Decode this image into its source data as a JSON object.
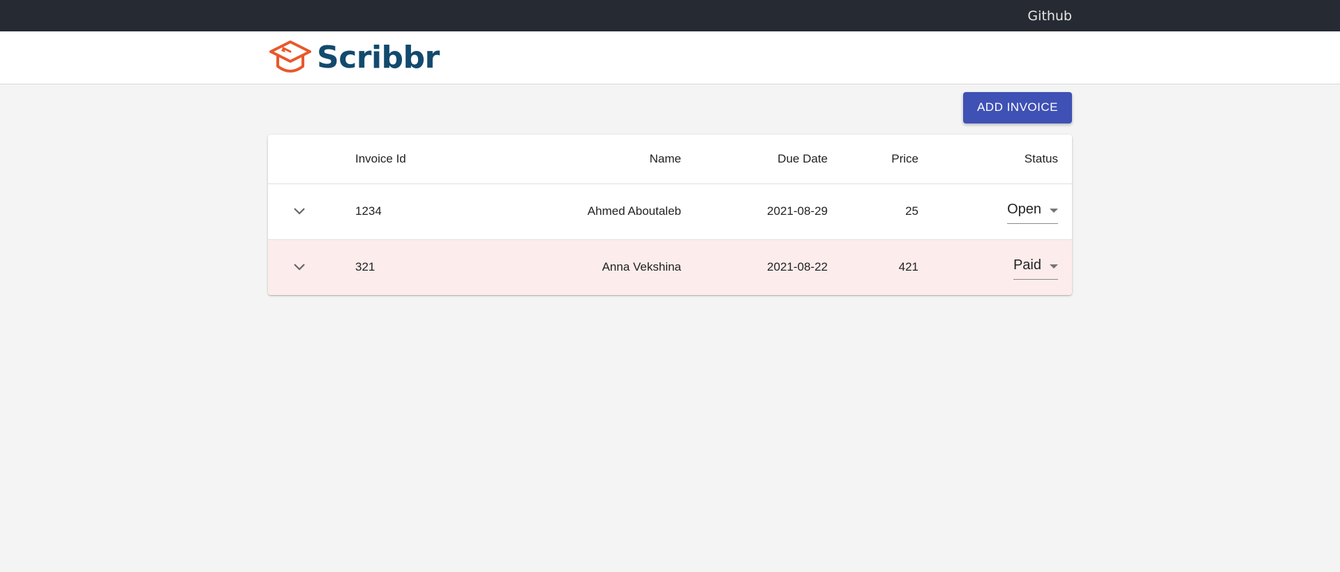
{
  "topbar": {
    "github_label": "Github"
  },
  "brand": {
    "name": "Scribbr",
    "logo_color": "#e8582a",
    "text_color": "#124a6e"
  },
  "actions": {
    "add_invoice_label": "ADD INVOICE",
    "button_color": "#3f51b5"
  },
  "table": {
    "headers": {
      "invoice_id": "Invoice Id",
      "name": "Name",
      "due_date": "Due Date",
      "price": "Price",
      "status": "Status"
    },
    "rows": [
      {
        "invoice_id": "1234",
        "name": "Ahmed Aboutaleb",
        "due_date": "2021-08-29",
        "price": "25",
        "status": "Open",
        "expand_icon": "chevron-down-icon"
      },
      {
        "invoice_id": "321",
        "name": "Anna Vekshina",
        "due_date": "2021-08-22",
        "price": "421",
        "status": "Paid",
        "expand_icon": "chevron-down-icon",
        "row_color": "#fdecec"
      }
    ]
  }
}
